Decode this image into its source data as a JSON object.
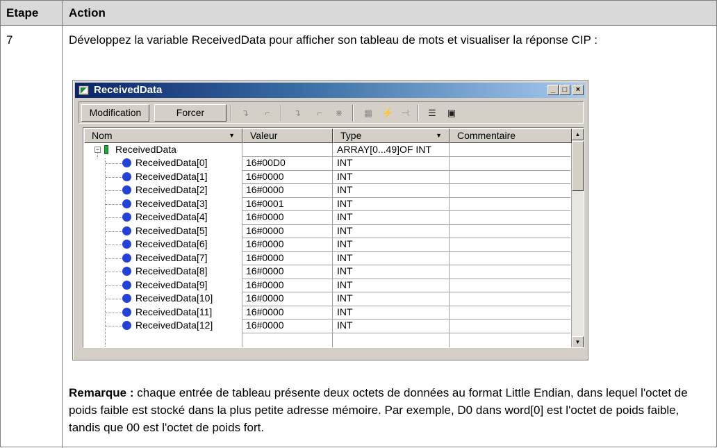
{
  "doc": {
    "header_step": "Etape",
    "header_action": "Action",
    "step_number": "7",
    "intro": "Développez la variable ReceivedData pour afficher son tableau de mots et visualiser la réponse CIP :",
    "remark_label": "Remarque :",
    "remark_text": " chaque entrée de tableau présente deux octets de données au format Little Endian, dans lequel l'octet de poids faible est stocké dans la plus petite adresse mémoire. Par exemple, D0 dans word[0] est l'octet de poids faible, tandis que 00 est l'octet de poids fort."
  },
  "window": {
    "title": "ReceivedData",
    "controls": {
      "minimize": "_",
      "maximize": "□",
      "close": "×"
    },
    "toolbar": {
      "modification_label": "Modification",
      "forcer_label": "Forcer"
    },
    "columns": {
      "nom": "Nom",
      "valeur": "Valeur",
      "type": "Type",
      "commentaire": "Commentaire"
    },
    "root": {
      "name": "ReceivedData",
      "value": "",
      "type": "ARRAY[0...49]OF INT"
    },
    "rows": [
      {
        "name": "ReceivedData[0]",
        "value": "16#00D0",
        "type": "INT"
      },
      {
        "name": "ReceivedData[1]",
        "value": "16#0000",
        "type": "INT"
      },
      {
        "name": "ReceivedData[2]",
        "value": "16#0000",
        "type": "INT"
      },
      {
        "name": "ReceivedData[3]",
        "value": "16#0001",
        "type": "INT"
      },
      {
        "name": "ReceivedData[4]",
        "value": "16#0000",
        "type": "INT"
      },
      {
        "name": "ReceivedData[5]",
        "value": "16#0000",
        "type": "INT"
      },
      {
        "name": "ReceivedData[6]",
        "value": "16#0000",
        "type": "INT"
      },
      {
        "name": "ReceivedData[7]",
        "value": "16#0000",
        "type": "INT"
      },
      {
        "name": "ReceivedData[8]",
        "value": "16#0000",
        "type": "INT"
      },
      {
        "name": "ReceivedData[9]",
        "value": "16#0000",
        "type": "INT"
      },
      {
        "name": "ReceivedData[10]",
        "value": "16#0000",
        "type": "INT"
      },
      {
        "name": "ReceivedData[11]",
        "value": "16#0000",
        "type": "INT"
      },
      {
        "name": "ReceivedData[12]",
        "value": "16#0000",
        "type": "INT"
      }
    ]
  }
}
